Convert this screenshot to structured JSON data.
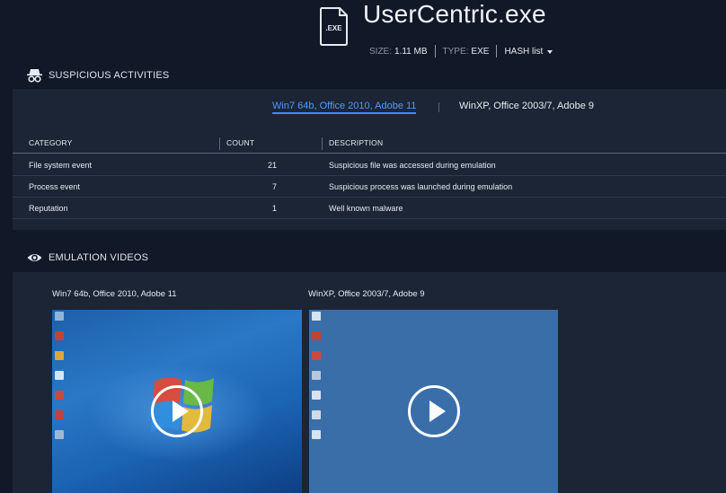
{
  "file": {
    "icon_text": ".EXE",
    "title": "UserCentric.exe",
    "size_label": "SIZE:",
    "size_value": "1.11 MB",
    "type_label": "TYPE:",
    "type_value": "EXE",
    "hash_label": "HASH list"
  },
  "suspicious": {
    "heading": "SUSPICIOUS ACTIVITIES",
    "icon": "spy-icon",
    "tabs": [
      {
        "label": "Win7 64b, Office 2010, Adobe 11",
        "active": true
      },
      {
        "label": "WinXP, Office 2003/7, Adobe 9",
        "active": false
      }
    ],
    "columns": [
      "CATEGORY",
      "COUNT",
      "DESCRIPTION"
    ],
    "rows": [
      {
        "category": "File system event",
        "count": "21",
        "description": "Suspicious file was accessed during emulation"
      },
      {
        "category": "Process event",
        "count": "7",
        "description": "Suspicious process was launched during emulation"
      },
      {
        "category": "Reputation",
        "count": "1",
        "description": "Well known malware"
      }
    ]
  },
  "videos": {
    "heading": "EMULATION VIDEOS",
    "icon": "eye-icon",
    "items": [
      {
        "label": "Win7 64b, Office 2010, Adobe 11"
      },
      {
        "label": "WinXP, Office 2003/7, Adobe 9"
      }
    ]
  },
  "colors": {
    "background": "#111827",
    "panel": "#1c2536",
    "accent": "#3a8cff"
  }
}
